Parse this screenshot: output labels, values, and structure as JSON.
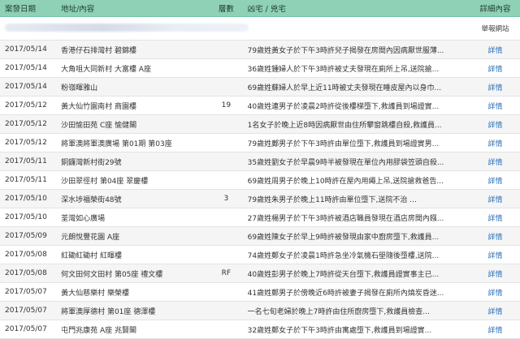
{
  "headers": {
    "date": "案發日期",
    "address": "地址/內容",
    "floor": "層數",
    "death": "凶宅 / 兇宅",
    "detail": "詳細內容"
  },
  "report_link": "舉報網站",
  "detail_label": "詳情",
  "accent_color": "#8ed1b7",
  "link_color": "#2a6fb8",
  "rows": [
    {
      "date": "2017/05/14",
      "address": "香港仔石排灣村 碧錦樓",
      "floor": "",
      "desc": "79歲姓黃女子於下午3時許兒子揭發在房間內因病厭世服薄..."
    },
    {
      "date": "2017/05/14",
      "address": "大角咀大同新村 大富樓 A座",
      "floor": "",
      "desc": "36歲姓鍾婦人於下午3時許被丈夫發現在廁所上吊,送院搶..."
    },
    {
      "date": "2017/05/14",
      "address": "粉嶺暉雅山",
      "floor": "",
      "desc": "69歲姓蘇婦人於早上近11時被丈夫發現在睡皮屋內以身巾..."
    },
    {
      "date": "2017/05/12",
      "address": "黃大仙竹園南村 商園樓",
      "floor": "19",
      "desc": "40歲姓連男子於凌晨2時許從後樓梯墮下,救護員到場證實..."
    },
    {
      "date": "2017/05/12",
      "address": "沙田愉田苑 C座 愉健閣",
      "floor": "",
      "desc": "1名女子於晚上近8時因病厭世由住所攀窗跳樓自殺,救護員..."
    },
    {
      "date": "2017/05/12",
      "address": "將軍澳將軍澳廣場 第01期 第03座",
      "floor": "",
      "desc": "79歲姓鄺男子於下午3時許由單位墮下,救護員到場證實男..."
    },
    {
      "date": "2017/05/11",
      "address": "銅鑼灣新村街29號",
      "floor": "",
      "desc": "35歲姓劉女子於早晨9時半被發現在單位內用膠袋笠頭自殺..."
    },
    {
      "date": "2017/05/11",
      "address": "沙田翠徑村 第04座 翠慶樓",
      "floor": "",
      "desc": "69歲姓周男子於晚上10時許在屋內用繩上吊,送院搶救爸告..."
    },
    {
      "date": "2017/05/10",
      "address": "深水埗福榮街48號",
      "floor": "3",
      "desc": "79歲姓朱男子於晚上11時許由單位墮下,送院不治 ..."
    },
    {
      "date": "2017/05/10",
      "address": "荃灣如心廣場",
      "floor": "",
      "desc": "27歲姓楊男子於下午3時許被酒店職員發現在酒店房間內鏹..."
    },
    {
      "date": "2017/05/09",
      "address": "元朗悅豐花園 A座",
      "floor": "",
      "desc": "69歲姓陳女子於早上9時許被發現由家中廚房墮下,救護員..."
    },
    {
      "date": "2017/05/08",
      "address": "紅磡紅磡村 紅暉樓",
      "floor": "",
      "desc": "74歲姓鄭女子於凌晨1時許急坐冷氣機石壆隨後墮樓,送院..."
    },
    {
      "date": "2017/05/08",
      "address": "何文田何文田村 第05座 禮文樓",
      "floor": "RF",
      "desc": "40歲姓彭男子於晚上7時許從天台墮下,救護員證實事主已..."
    },
    {
      "date": "2017/05/07",
      "address": "黃大仙慈樂村 樂榮樓",
      "floor": "",
      "desc": "41歲姓鄭男子於傍晚近6時許被妻子揭發在廁所內燒炭昏迷..."
    },
    {
      "date": "2017/05/07",
      "address": "將軍澳厚德村 第01座 德澤樓",
      "floor": "",
      "desc": "一名七旬老婦於晚上7時許由住所廚房墮下,救護員檢查..."
    },
    {
      "date": "2017/05/07",
      "address": "屯門兆康苑 A座 兆賢閣",
      "floor": "",
      "desc": "32歲姓鄭女子於下午3時許由寓處墮下,救護員到場證實..."
    }
  ]
}
